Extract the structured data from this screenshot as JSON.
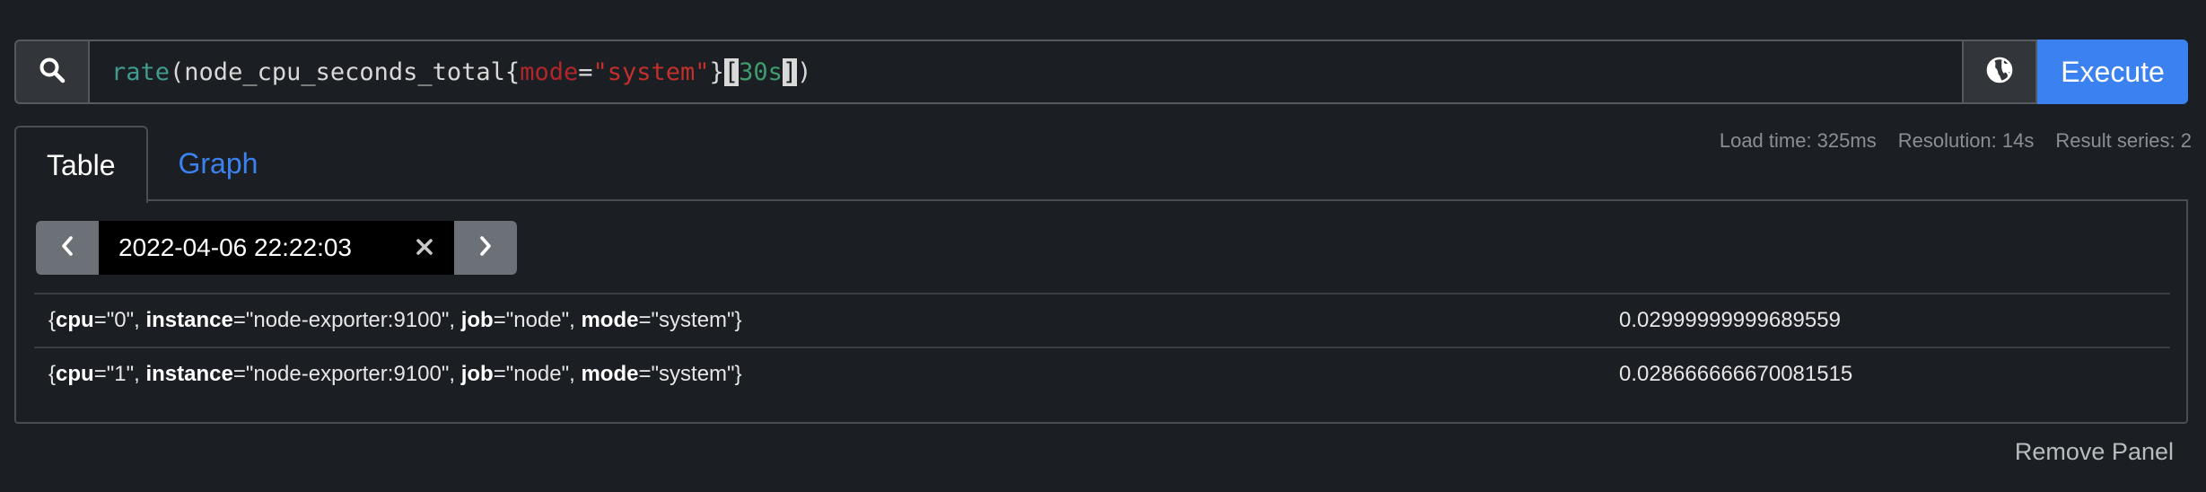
{
  "query": {
    "fn": "rate",
    "open_paren": "(",
    "metric": "node_cpu_seconds_total",
    "open_brace": "{",
    "label": "mode",
    "eq": "=",
    "value": "\"system\"",
    "close_brace": "}",
    "bracket_open": "[",
    "range": "30s",
    "bracket_close": "]",
    "close_paren": ")"
  },
  "execute_label": "Execute",
  "tabs": [
    {
      "label": "Table",
      "active": true
    },
    {
      "label": "Graph",
      "active": false
    }
  ],
  "stats": {
    "load_time": "Load time: 325ms",
    "resolution": "Resolution: 14s",
    "result_series": "Result series: 2"
  },
  "time_nav": {
    "value": "2022-04-06 22:22:03"
  },
  "results": [
    {
      "cpu_key": "cpu",
      "cpu_val": "=\"0\", ",
      "instance_key": "instance",
      "instance_val": "=\"node-exporter:9100\", ",
      "job_key": "job",
      "job_val": "=\"node\", ",
      "mode_key": "mode",
      "mode_val": "=\"system\"}",
      "value": "0.02999999999689559"
    },
    {
      "cpu_key": "cpu",
      "cpu_val": "=\"1\", ",
      "instance_key": "instance",
      "instance_val": "=\"node-exporter:9100\", ",
      "job_key": "job",
      "job_val": "=\"node\", ",
      "mode_key": "mode",
      "mode_val": "=\"system\"}",
      "value": "0.028666666670081515"
    }
  ],
  "remove_panel_label": "Remove Panel",
  "icons": {
    "search": "search-icon",
    "globe": "globe-icon",
    "prev": "chevron-left-icon",
    "next": "chevron-right-icon",
    "clear": "close-icon"
  },
  "colors": {
    "accent": "#3b82f0",
    "background": "#1b1e22",
    "query_function": "#3f9c8e",
    "query_string": "#c2302d"
  }
}
